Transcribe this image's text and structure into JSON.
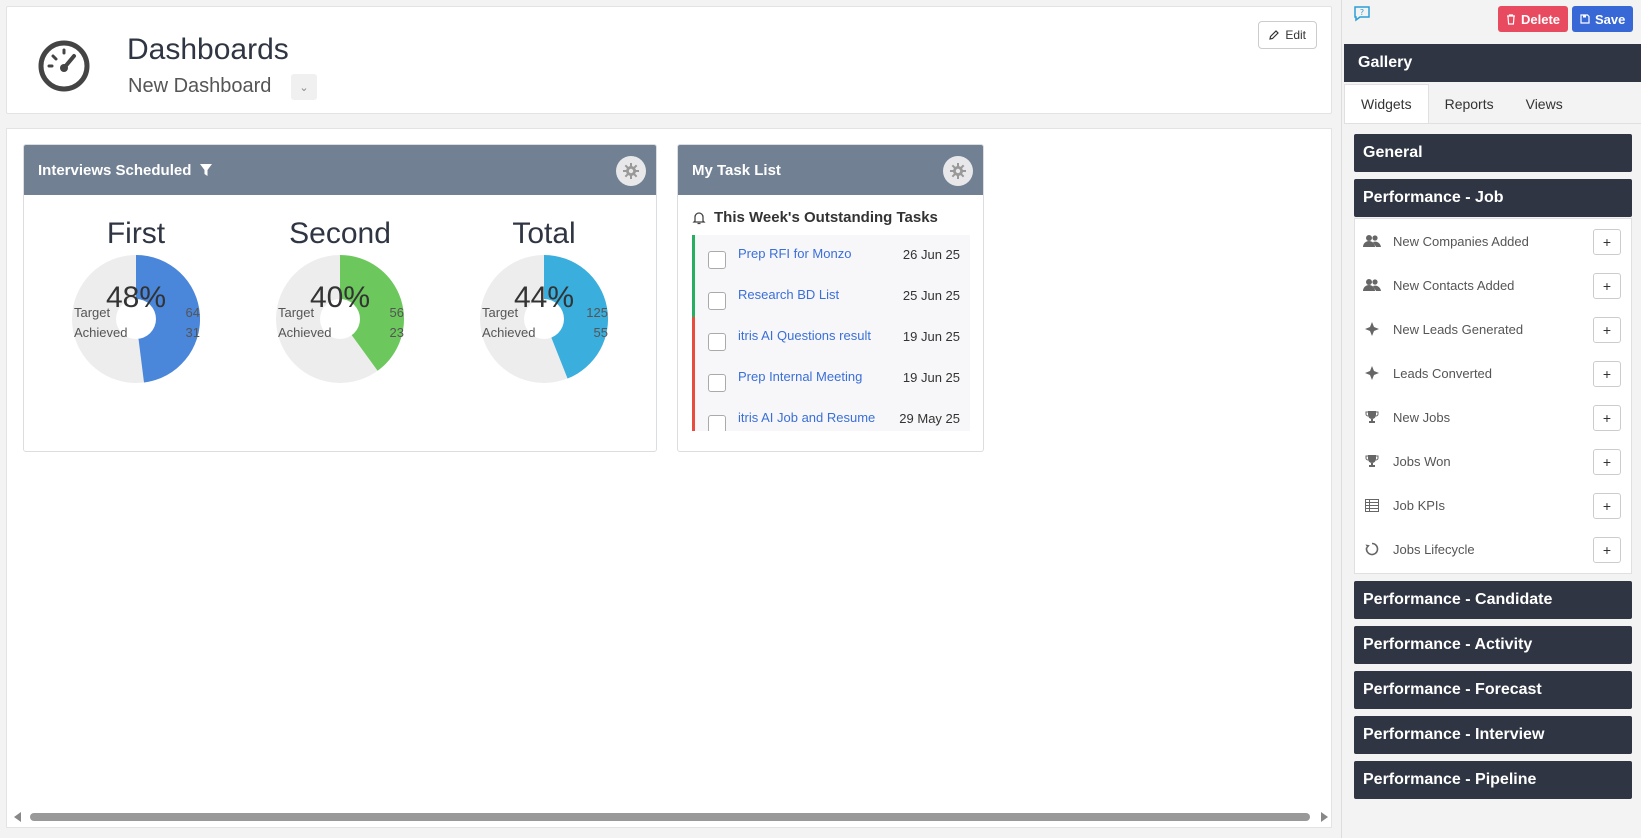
{
  "header": {
    "title": "Dashboards",
    "dashboard_name": "New Dashboard",
    "caret": "⌄",
    "edit_label": "Edit"
  },
  "widgets": {
    "interviews": {
      "title": "Interviews Scheduled",
      "legend_target": "Target",
      "legend_achieved": "Achieved",
      "donuts": [
        {
          "label": "First",
          "pct_text": "48%",
          "fraction": 0.48,
          "target": "64",
          "achieved": "31",
          "color": "#4a86d9"
        },
        {
          "label": "Second",
          "pct_text": "40%",
          "fraction": 0.4,
          "target": "56",
          "achieved": "23",
          "color": "#6cc85d"
        },
        {
          "label": "Total",
          "pct_text": "44%",
          "fraction": 0.44,
          "target": "125",
          "achieved": "55",
          "color": "#3aaedc"
        }
      ]
    },
    "tasks": {
      "title": "My Task List",
      "section": "This Week's Outstanding Tasks",
      "items": [
        {
          "name": "Prep RFI for Monzo",
          "date": "26 Jun 25",
          "status": "green"
        },
        {
          "name": "Research BD List",
          "date": "25 Jun 25",
          "status": "green"
        },
        {
          "name": "itris AI Questions result",
          "date": "19 Jun 25",
          "status": "red"
        },
        {
          "name": "Prep Internal Meeting",
          "date": "19 Jun 25",
          "status": "red"
        },
        {
          "name": "itris AI Job and Resume",
          "date": "29 May 25",
          "status": "red"
        }
      ]
    }
  },
  "side": {
    "delete_label": "Delete",
    "save_label": "Save",
    "gallery_title": "Gallery",
    "tabs": [
      "Widgets",
      "Reports",
      "Views"
    ],
    "sections": {
      "general": "General",
      "perf_job": "Performance - Job",
      "perf_candidate": "Performance - Candidate",
      "perf_activity": "Performance - Activity",
      "perf_forecast": "Performance - Forecast",
      "perf_interview": "Performance - Interview",
      "perf_pipeline": "Performance - Pipeline"
    },
    "job_items": [
      {
        "label": "New Companies Added",
        "icon": "users-icon"
      },
      {
        "label": "New Contacts Added",
        "icon": "users-icon"
      },
      {
        "label": "New Leads Generated",
        "icon": "crosshair-icon"
      },
      {
        "label": "Leads Converted",
        "icon": "crosshair-icon"
      },
      {
        "label": "New Jobs",
        "icon": "trophy-icon"
      },
      {
        "label": "Jobs Won",
        "icon": "trophy-icon"
      },
      {
        "label": "Job KPIs",
        "icon": "table-icon"
      },
      {
        "label": "Jobs Lifecycle",
        "icon": "cycle-icon"
      }
    ],
    "add_symbol": "+"
  }
}
